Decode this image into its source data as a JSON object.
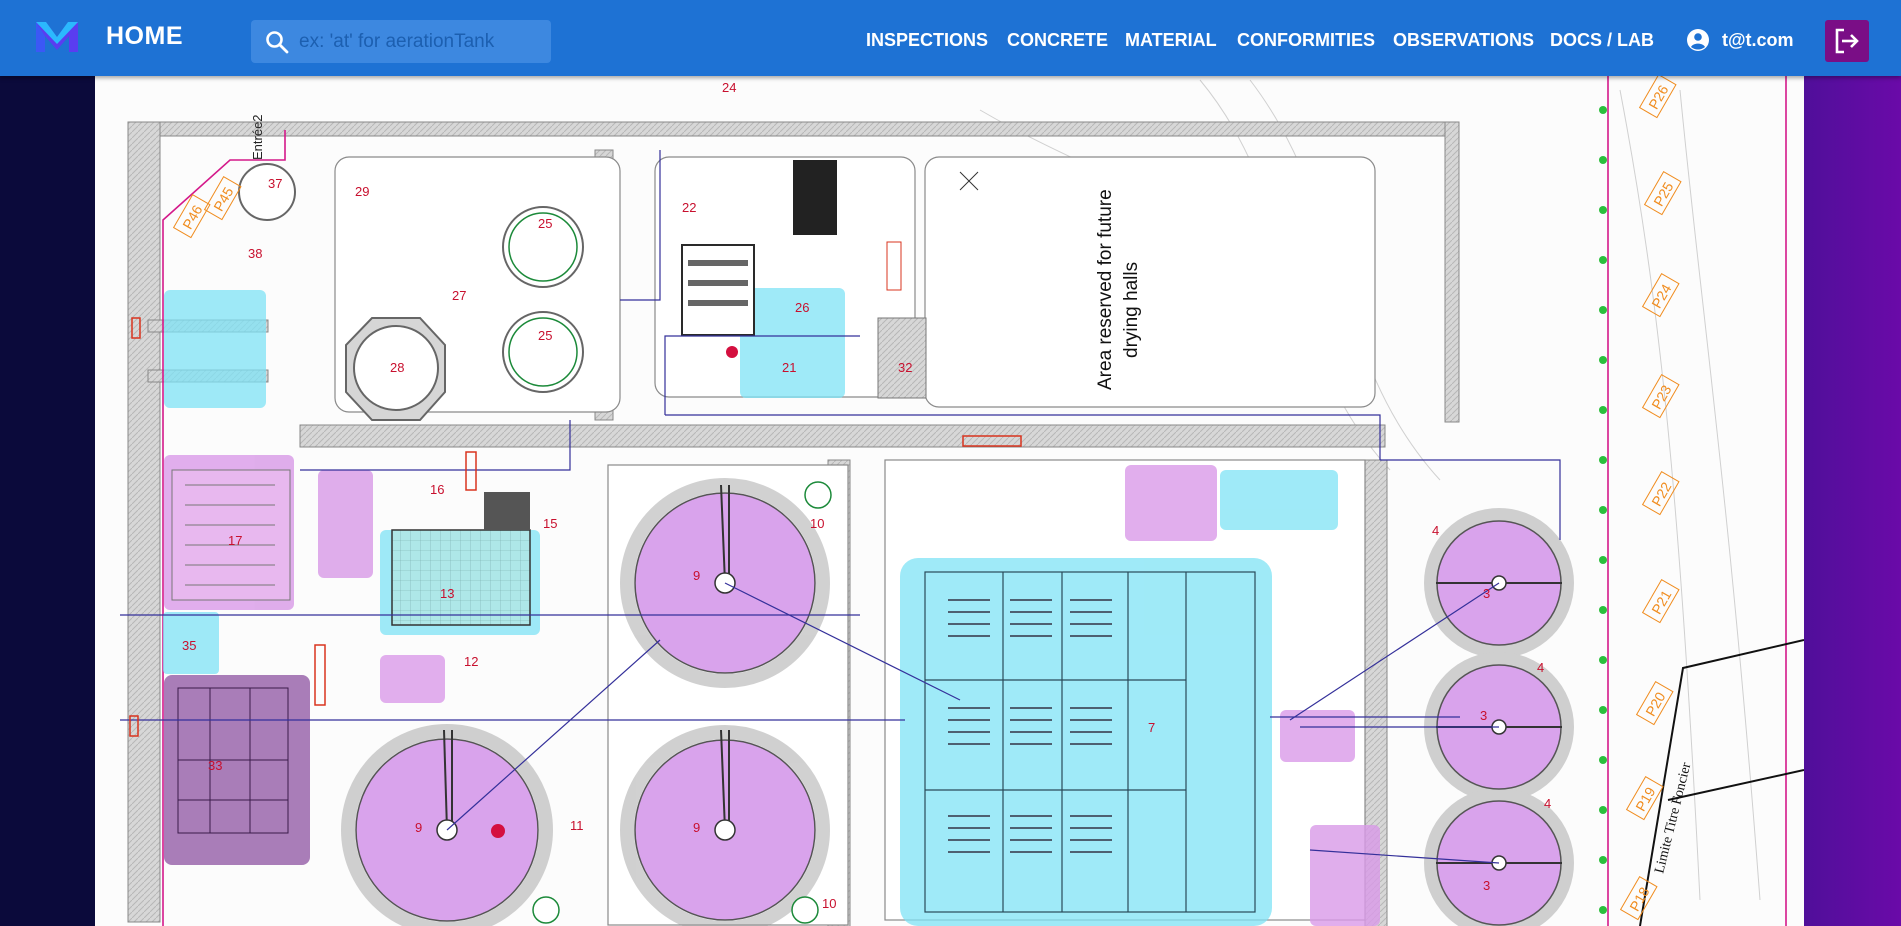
{
  "app": {
    "home_label": "HOME"
  },
  "search": {
    "placeholder": "ex: 'at' for aerationTank",
    "value": ""
  },
  "nav": [
    {
      "label": "INSPECTIONS"
    },
    {
      "label": "CONCRETE"
    },
    {
      "label": "MATERIAL"
    },
    {
      "label": "CONFORMITIES"
    },
    {
      "label": "OBSERVATIONS"
    },
    {
      "label": "DOCS / LAB"
    }
  ],
  "user": {
    "email": "t@t.com"
  },
  "plan": {
    "future_area_line1": "Area reserved for future",
    "future_area_line2": "drying halls",
    "entrance_label": "Entrée2",
    "boundary_label": "Limite Titre Foncier",
    "units": [
      {
        "num": "3"
      },
      {
        "num": "3"
      },
      {
        "num": "3"
      },
      {
        "num": "4"
      },
      {
        "num": "4"
      },
      {
        "num": "4"
      },
      {
        "num": "7"
      },
      {
        "num": "9"
      },
      {
        "num": "9"
      },
      {
        "num": "9"
      },
      {
        "num": "10"
      },
      {
        "num": "10"
      },
      {
        "num": "11"
      },
      {
        "num": "12"
      },
      {
        "num": "13"
      },
      {
        "num": "15"
      },
      {
        "num": "16"
      },
      {
        "num": "17"
      },
      {
        "num": "21"
      },
      {
        "num": "22"
      },
      {
        "num": "24"
      },
      {
        "num": "25"
      },
      {
        "num": "25"
      },
      {
        "num": "26"
      },
      {
        "num": "27"
      },
      {
        "num": "28"
      },
      {
        "num": "29"
      },
      {
        "num": "32"
      },
      {
        "num": "33"
      },
      {
        "num": "35"
      },
      {
        "num": "37"
      },
      {
        "num": "38"
      }
    ],
    "piles": [
      "P45",
      "P46",
      "P26",
      "P25",
      "P24",
      "P23",
      "P22",
      "P21",
      "P20",
      "P19",
      "P18"
    ]
  },
  "colors": {
    "topbar": "#1e72d4",
    "logout": "#7a0e86",
    "cyan_zone": "#7fe3f5",
    "magenta_zone": "#d99ae8",
    "pile_tag": "#f08c1e"
  }
}
